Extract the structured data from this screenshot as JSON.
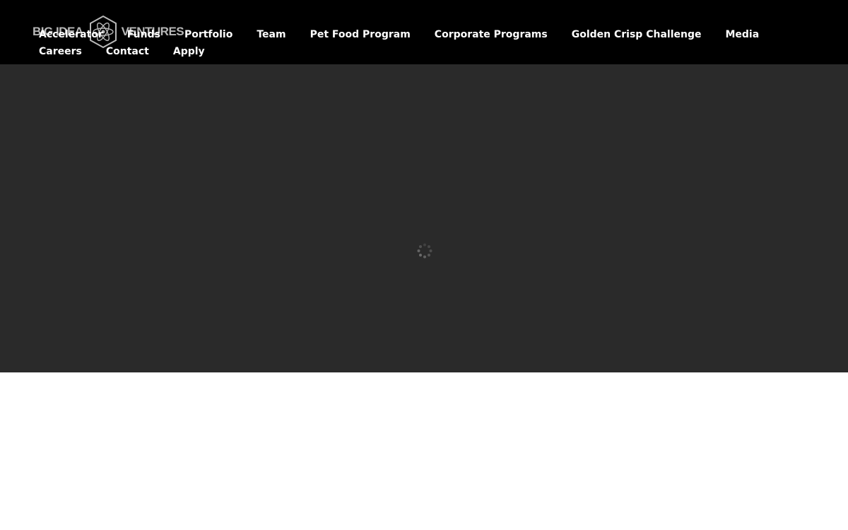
{
  "brand": {
    "logo_left": "BIG IDEA",
    "logo_right": "VENTURES",
    "logo_icon": "atom-hexagon-icon"
  },
  "nav": {
    "items": [
      {
        "label": "Accelerator"
      },
      {
        "label": "Funds"
      },
      {
        "label": "Portfolio"
      },
      {
        "label": "Team"
      },
      {
        "label": "Pet Food Program"
      },
      {
        "label": "Corporate Programs"
      },
      {
        "label": "Golden Crisp Challenge"
      },
      {
        "label": "Media"
      },
      {
        "label": "Careers"
      },
      {
        "label": "Contact"
      },
      {
        "label": "Apply"
      }
    ]
  },
  "hero": {
    "loading_icon": "loading-spinner-icon",
    "background": "#2a2a2a"
  },
  "colors": {
    "header_bg": "#000000",
    "nav_text": "#ffffff",
    "page_bg": "#ffffff"
  }
}
